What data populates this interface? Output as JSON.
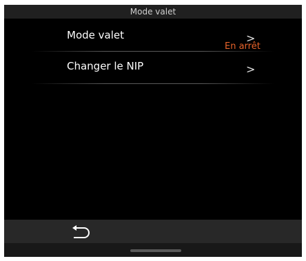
{
  "header": {
    "title": "Mode valet"
  },
  "menu": {
    "items": [
      {
        "label": "Mode valet",
        "status": "En arrêt",
        "chevron": ">"
      },
      {
        "label": "Changer le NIP",
        "chevron": ">"
      }
    ]
  },
  "bottom_bar": {
    "back_icon": "back-arrow-icon"
  },
  "colors": {
    "status": "#e8632a",
    "background": "#000000"
  }
}
